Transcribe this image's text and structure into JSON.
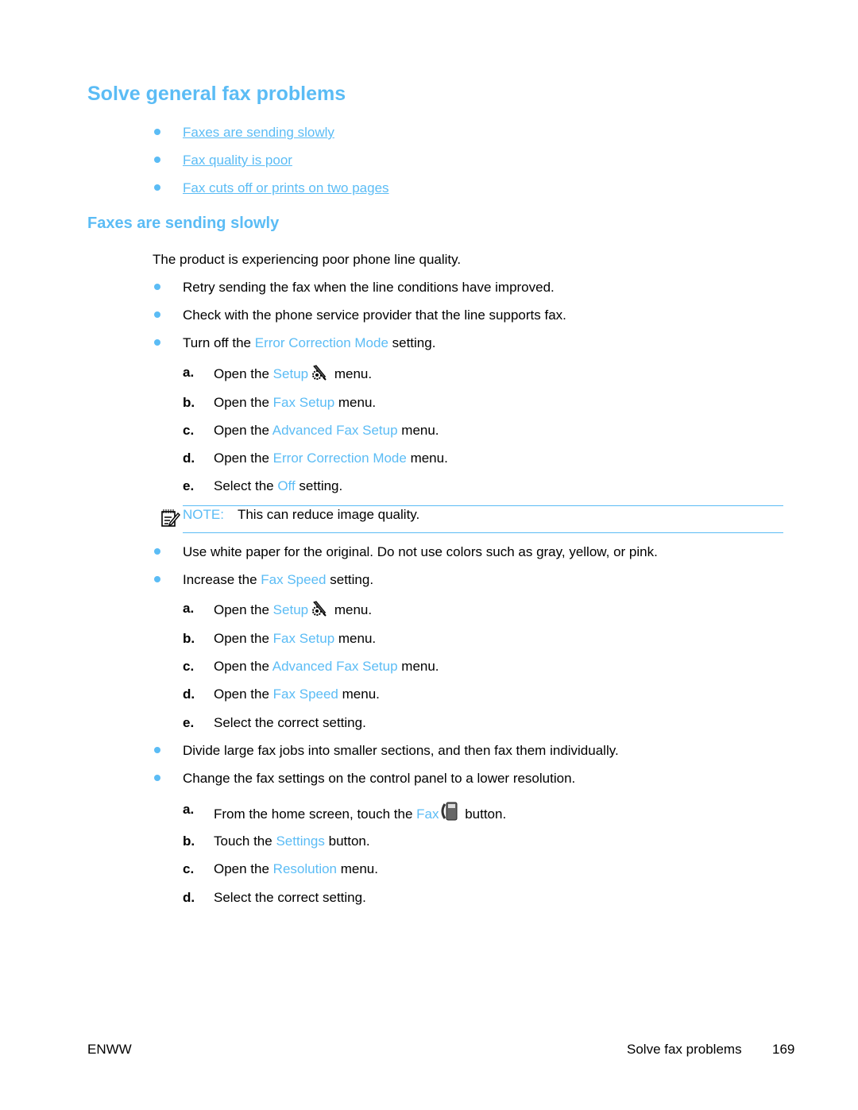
{
  "title": "Solve general fax problems",
  "toc": [
    "Faxes are sending slowly",
    "Fax quality is poor",
    "Fax cuts off or prints on two pages"
  ],
  "section": {
    "heading": "Faxes are sending slowly",
    "intro": "The product is experiencing poor phone line quality.",
    "bullet1": "Retry sending the fax when the line conditions have improved.",
    "bullet2": "Check with the phone service provider that the line supports fax.",
    "bullet3": {
      "pre": "Turn off the ",
      "link": "Error Correction Mode",
      "post": " setting."
    },
    "steps1": [
      {
        "letter": "a.",
        "pre": "Open the ",
        "link": "Setup",
        "icon": "setup-wrench-gear-icon",
        "post": " menu."
      },
      {
        "letter": "b.",
        "pre": "Open the ",
        "link": "Fax Setup",
        "post": " menu."
      },
      {
        "letter": "c.",
        "pre": "Open the ",
        "link": "Advanced Fax Setup",
        "post": " menu."
      },
      {
        "letter": "d.",
        "pre": "Open the ",
        "link": "Error Correction Mode",
        "post": " menu."
      },
      {
        "letter": "e.",
        "pre": "Select the ",
        "link": "Off",
        "post": " setting."
      }
    ],
    "note": {
      "label": "NOTE:",
      "text": "This can reduce image quality.",
      "icon": "note-pad-icon"
    },
    "bullet4": "Use white paper for the original. Do not use colors such as gray, yellow, or pink.",
    "bullet5": {
      "pre": "Increase the ",
      "link": "Fax Speed",
      "post": " setting."
    },
    "steps2": [
      {
        "letter": "a.",
        "pre": "Open the ",
        "link": "Setup",
        "icon": "setup-wrench-gear-icon",
        "post": " menu."
      },
      {
        "letter": "b.",
        "pre": "Open the ",
        "link": "Fax Setup",
        "post": " menu."
      },
      {
        "letter": "c.",
        "pre": "Open the ",
        "link": "Advanced Fax Setup",
        "post": " menu."
      },
      {
        "letter": "d.",
        "pre": "Open the ",
        "link": "Fax Speed",
        "post": " menu."
      },
      {
        "letter": "e.",
        "pre": "Select the correct setting.",
        "link": "",
        "post": ""
      }
    ],
    "bullet6": "Divide large fax jobs into smaller sections, and then fax them individually.",
    "bullet7": "Change the fax settings on the control panel to a lower resolution.",
    "steps3": [
      {
        "letter": "a.",
        "pre": "From the home screen, touch the ",
        "link": "Fax",
        "icon": "fax-phone-icon",
        "post": " button."
      },
      {
        "letter": "b.",
        "pre": "Touch the ",
        "link": "Settings",
        "post": " button."
      },
      {
        "letter": "c.",
        "pre": "Open the ",
        "link": "Resolution",
        "post": " menu."
      },
      {
        "letter": "d.",
        "pre": "Select the correct setting.",
        "link": "",
        "post": ""
      }
    ]
  },
  "footer": {
    "left": "ENWW",
    "section": "Solve fax problems",
    "page": "169"
  },
  "colors": {
    "accent": "#5bbcf5"
  }
}
